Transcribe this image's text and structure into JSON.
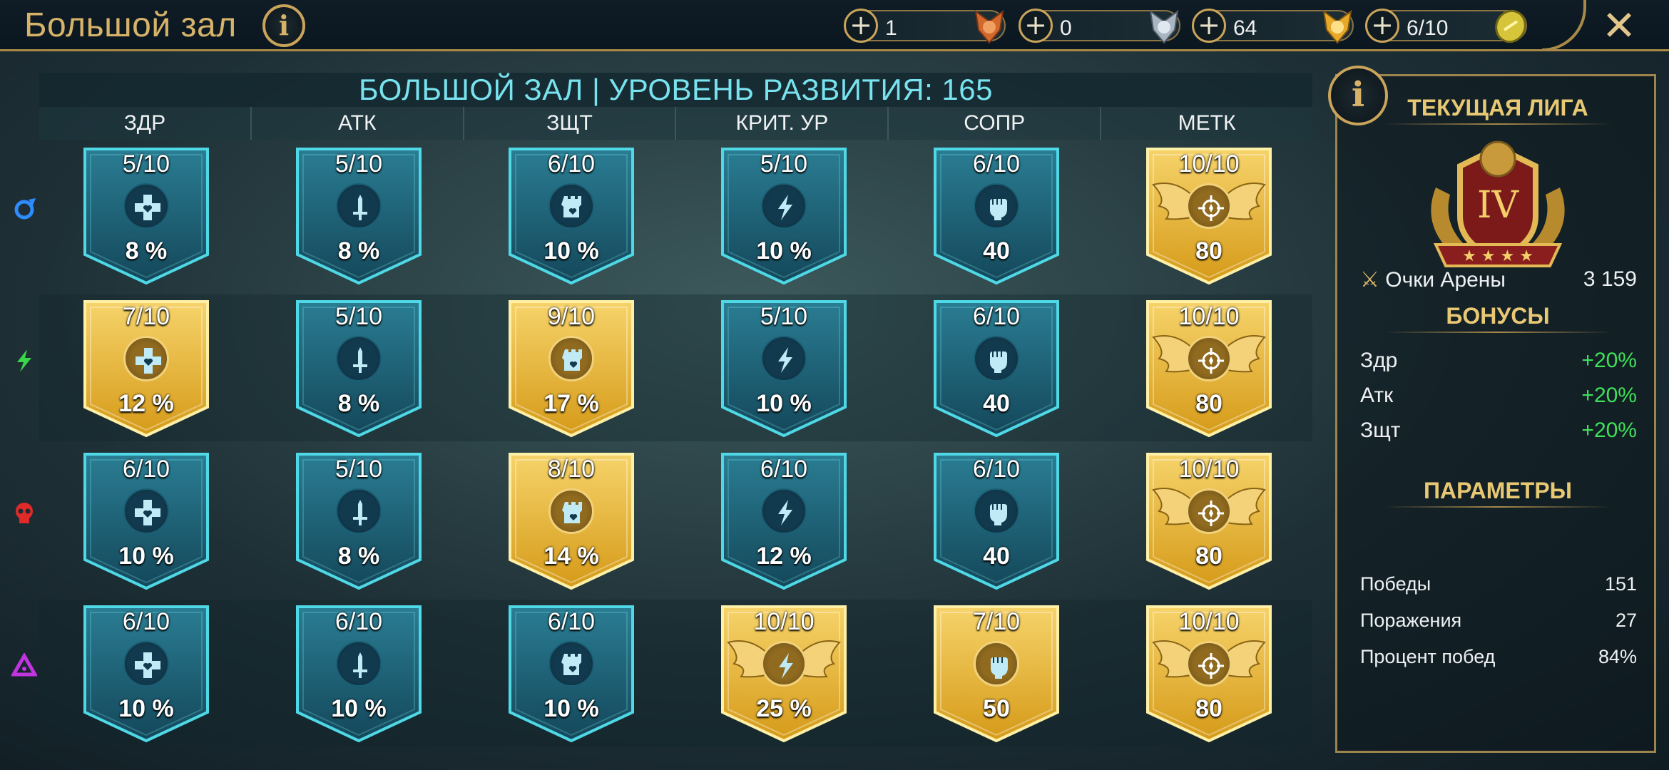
{
  "header": {
    "title": "Большой зал",
    "resources": [
      {
        "value": "1",
        "icon": "bronze-medal-icon"
      },
      {
        "value": "0",
        "icon": "silver-medal-icon"
      },
      {
        "value": "64",
        "icon": "gold-medal-icon"
      },
      {
        "value": "6/10",
        "icon": "arena-token-icon"
      }
    ]
  },
  "grid": {
    "title": "БОЛЬШОЙ ЗАЛ | УРОВЕНЬ РАЗВИТИЯ: 165",
    "columns": [
      "ЗДР",
      "АТК",
      "ЗЩТ",
      "КРИТ. УР",
      "СОПР",
      "МЕТК"
    ],
    "column_icons": [
      "heart-cross-icon",
      "sword-icon",
      "tower-shield-icon",
      "lightning-icon",
      "fist-icon",
      "crosshair-icon"
    ],
    "rows": [
      {
        "affinity": "magic-affinity-icon",
        "affinity_color": "#2f8cff",
        "cells": [
          {
            "level": "5/10",
            "value": "8 %",
            "style": "blue"
          },
          {
            "level": "5/10",
            "value": "8 %",
            "style": "blue"
          },
          {
            "level": "6/10",
            "value": "10 %",
            "style": "blue"
          },
          {
            "level": "5/10",
            "value": "10 %",
            "style": "blue"
          },
          {
            "level": "6/10",
            "value": "40",
            "style": "blue"
          },
          {
            "level": "10/10",
            "value": "80",
            "style": "gold-max"
          }
        ]
      },
      {
        "affinity": "spirit-affinity-icon",
        "affinity_color": "#39d84a",
        "cells": [
          {
            "level": "7/10",
            "value": "12 %",
            "style": "gold"
          },
          {
            "level": "5/10",
            "value": "8 %",
            "style": "blue"
          },
          {
            "level": "9/10",
            "value": "17 %",
            "style": "gold"
          },
          {
            "level": "5/10",
            "value": "10 %",
            "style": "blue"
          },
          {
            "level": "6/10",
            "value": "40",
            "style": "blue"
          },
          {
            "level": "10/10",
            "value": "80",
            "style": "gold-max"
          }
        ]
      },
      {
        "affinity": "force-affinity-icon",
        "affinity_color": "#e02a2a",
        "cells": [
          {
            "level": "6/10",
            "value": "10 %",
            "style": "blue"
          },
          {
            "level": "5/10",
            "value": "8 %",
            "style": "blue"
          },
          {
            "level": "8/10",
            "value": "14 %",
            "style": "gold"
          },
          {
            "level": "6/10",
            "value": "12 %",
            "style": "blue"
          },
          {
            "level": "6/10",
            "value": "40",
            "style": "blue"
          },
          {
            "level": "10/10",
            "value": "80",
            "style": "gold-max"
          }
        ]
      },
      {
        "affinity": "void-affinity-icon",
        "affinity_color": "#c035e0",
        "cells": [
          {
            "level": "6/10",
            "value": "10 %",
            "style": "blue"
          },
          {
            "level": "6/10",
            "value": "10 %",
            "style": "blue"
          },
          {
            "level": "6/10",
            "value": "10 %",
            "style": "blue"
          },
          {
            "level": "10/10",
            "value": "25 %",
            "style": "gold-max"
          },
          {
            "level": "7/10",
            "value": "50",
            "style": "gold"
          },
          {
            "level": "10/10",
            "value": "80",
            "style": "gold-max"
          }
        ]
      }
    ]
  },
  "panel": {
    "league_title": "ТЕКУЩАЯ ЛИГА",
    "league_rank": "IV",
    "arena_points_label": "Очки Арены",
    "arena_points_value": "3 159",
    "bonuses_title": "БОНУСЫ",
    "bonuses": [
      {
        "label": "Здр",
        "value": "+20%"
      },
      {
        "label": "Атк",
        "value": "+20%"
      },
      {
        "label": "Зщт",
        "value": "+20%"
      }
    ],
    "params_title": "ПАРАМЕТРЫ",
    "params": [
      {
        "label": "Победы",
        "value": "151"
      },
      {
        "label": "Поражения",
        "value": "27"
      },
      {
        "label": "Процент побед",
        "value": "84%"
      }
    ]
  },
  "colors": {
    "accent_gold": "#d7b36a",
    "banner_cyan": "#78e2ee",
    "bonus_green": "#3fe05a",
    "badge_blue": "#1d5a6e",
    "badge_gold": "#e9b22c"
  }
}
